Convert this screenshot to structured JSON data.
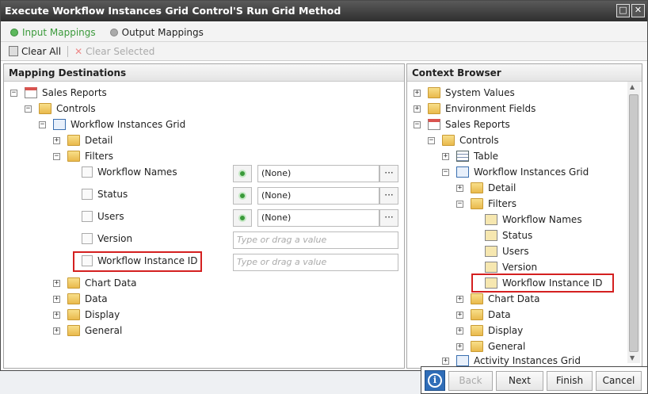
{
  "window": {
    "title": "Execute Workflow Instances Grid Control'S Run Grid Method"
  },
  "tabs": {
    "input": "Input Mappings",
    "output": "Output Mappings"
  },
  "toolbar": {
    "clear_all": "Clear All",
    "clear_selected": "Clear Selected"
  },
  "mapping": {
    "header": "Mapping Destinations",
    "sales_reports": "Sales Reports",
    "controls": "Controls",
    "grid": "Workflow Instances Grid",
    "detail": "Detail",
    "filters": "Filters",
    "workflow_names": "Workflow Names",
    "status": "Status",
    "users": "Users",
    "version": "Version",
    "instance_id": "Workflow Instance ID",
    "none": "(None)",
    "placeholder": "Type or drag a value",
    "ellipsis": "···",
    "chart_data": "Chart Data",
    "data": "Data",
    "display": "Display",
    "general": "General"
  },
  "context": {
    "header": "Context Browser",
    "system_values": "System Values",
    "environment_fields": "Environment Fields",
    "sales_reports": "Sales Reports",
    "controls": "Controls",
    "table": "Table",
    "grid": "Workflow Instances Grid",
    "detail": "Detail",
    "filters": "Filters",
    "workflow_names": "Workflow Names",
    "status": "Status",
    "users": "Users",
    "version": "Version",
    "instance_id": "Workflow Instance ID",
    "chart_data": "Chart Data",
    "data": "Data",
    "display": "Display",
    "general": "General",
    "activity_grid": "Activity Instances Grid"
  },
  "footer": {
    "back": "Back",
    "next": "Next",
    "finish": "Finish",
    "cancel": "Cancel"
  }
}
